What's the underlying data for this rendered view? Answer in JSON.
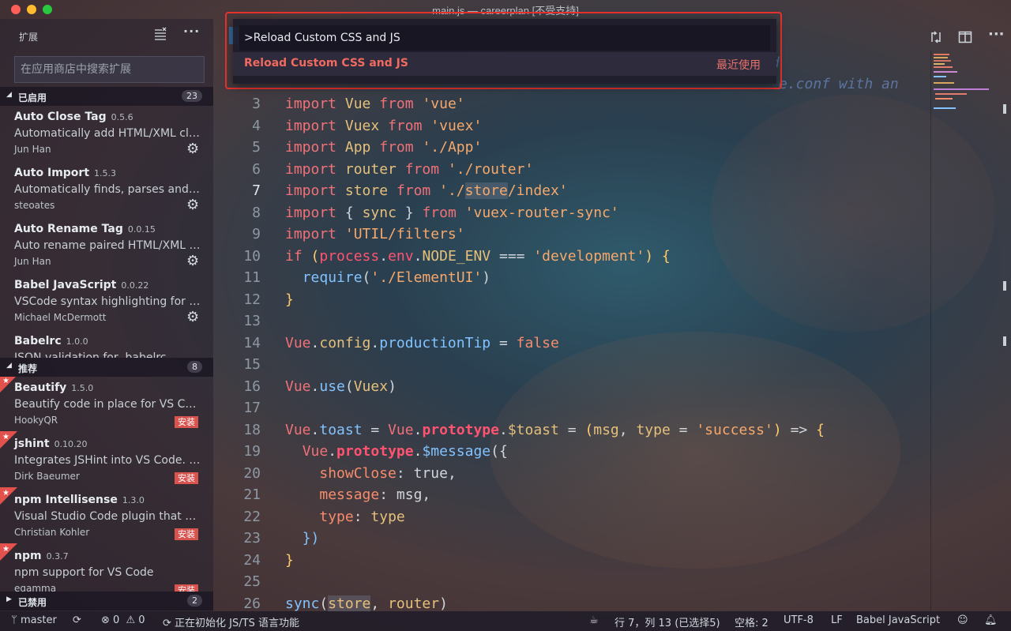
{
  "window": {
    "title": "main.js — careerplan [不受支持]"
  },
  "sidebar": {
    "title": "扩展",
    "search_placeholder": "在应用商店中搜索扩展",
    "sections": {
      "enabled": {
        "label": "已启用",
        "count": "23"
      },
      "recommended": {
        "label": "推荐",
        "count": "8"
      },
      "disabled": {
        "label": "已禁用",
        "count": "2"
      }
    },
    "enabled_extensions": [
      {
        "name": "Auto Close Tag",
        "version": "0.5.6",
        "description": "Automatically add HTML/XML close tag, same as Visual Studio IDE or Sublime Text",
        "author": "Jun Han"
      },
      {
        "name": "Auto Import",
        "version": "1.5.3",
        "description": "Automatically finds, parses and provides code actions and code completion for all available imports",
        "author": "steoates"
      },
      {
        "name": "Auto Rename Tag",
        "version": "0.0.15",
        "description": "Auto rename paired HTML/XML tag",
        "author": "Jun Han"
      },
      {
        "name": "Babel JavaScript",
        "version": "0.0.22",
        "description": "VSCode syntax highlighting for today's JavaScript",
        "author": "Michael McDermott"
      },
      {
        "name": "Babelrc",
        "version": "1.0.0",
        "description": "JSON validation for .babelrc",
        "author": ""
      }
    ],
    "recommended_extensions": [
      {
        "name": "Beautify",
        "version": "1.5.0",
        "description": "Beautify code in place for VS Code",
        "author": "HookyQR",
        "install_label": "安装"
      },
      {
        "name": "jshint",
        "version": "0.10.20",
        "description": "Integrates JSHint into VS Code. JSHint is a linter for JavaScript",
        "author": "Dirk Baeumer",
        "install_label": "安装"
      },
      {
        "name": "npm Intellisense",
        "version": "1.3.0",
        "description": "Visual Studio Code plugin that autocompletes npm modules in import statements",
        "author": "Christian Kohler",
        "install_label": "安装"
      },
      {
        "name": "npm",
        "version": "0.3.7",
        "description": "npm support for VS Code",
        "author": "egamma",
        "install_label": "安装"
      }
    ]
  },
  "quick_open": {
    "input_value": ">Reload Custom CSS and JS",
    "item_label": "Reload Custom CSS and JS",
    "item_tag": "最近使用"
  },
  "editor": {
    "ghost_text": "e.conf with an",
    "ghost_text_1": "d",
    "line_numbers": [
      "3",
      "4",
      "5",
      "6",
      "7",
      "8",
      "9",
      "10",
      "11",
      "12",
      "13",
      "14",
      "15",
      "16",
      "17",
      "18",
      "19",
      "20",
      "21",
      "22",
      "23",
      "24",
      "25",
      "26"
    ],
    "active_line": "7"
  },
  "statusbar": {
    "branch": "master",
    "errors": "0",
    "warnings": "0",
    "initializing": "正在初始化 JS/TS 语言功能",
    "position": "行 7，列 13 (已选择5)",
    "spaces": "空格: 2",
    "encoding": "UTF-8",
    "eol": "LF",
    "language": "Babel JavaScript"
  },
  "icons": {
    "clear": "clear-list-icon",
    "more": "more-icon",
    "gear": "gear-icon",
    "star": "star-icon",
    "branch": "git-branch-icon",
    "sync": "sync-icon",
    "error": "error-icon",
    "warning": "warning-icon",
    "smiley": "smiley-icon",
    "bell": "bell-icon",
    "split": "split-editor-icon",
    "compare": "open-changes-icon"
  },
  "colors": {
    "accent": "#f06a60",
    "install": "#d9534f",
    "highlight": "#e8322e"
  }
}
